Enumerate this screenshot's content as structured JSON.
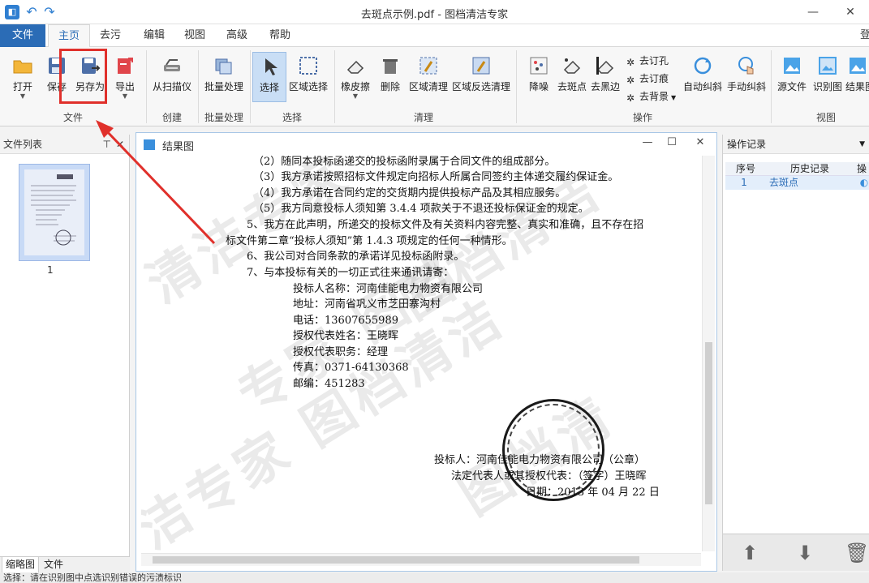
{
  "window": {
    "title": "去斑点示例.pdf - 图档清洁专家",
    "min_glyph": "—",
    "max_glyph": "☐",
    "close_glyph": "✕"
  },
  "menu_tabs": {
    "file": "文件",
    "home": "主页",
    "denoise": "去污",
    "edit": "编辑",
    "view": "视图",
    "advanced": "高级",
    "help": "帮助",
    "login": "登"
  },
  "ribbon": {
    "file_group": {
      "label": "文件",
      "open": "打开",
      "save": "保存",
      "save_as": "另存为",
      "export": "导出"
    },
    "create_group": {
      "label": "创建",
      "scanner": "从扫描仪"
    },
    "batch_group": {
      "label": "批量处理",
      "batch": "批量处理"
    },
    "select_group": {
      "label": "选择",
      "select": "选择",
      "region_select": "区域选择"
    },
    "clean_group": {
      "label": "清理",
      "eraser": "橡皮擦",
      "delete": "删除",
      "region_clean": "区域清理",
      "region_inverse_clean": "区域反选清理"
    },
    "ops_group": {
      "label": "操作",
      "denoise": "降噪",
      "remove_spots": "去斑点",
      "remove_black_edges": "去黑边",
      "remove_holes": "去订孔",
      "remove_staple_marks": "去订痕",
      "remove_background": "去背景",
      "auto_deskew": "自动纠斜",
      "manual_deskew": "手动纠斜"
    },
    "view_group": {
      "label": "视图",
      "source": "源文件",
      "recognize": "识别图",
      "result": "结果图"
    }
  },
  "left_panel": {
    "title": "文件列表",
    "page_number": "1",
    "tabs": [
      "缩略图",
      "文件"
    ]
  },
  "doc_window": {
    "title": "结果图",
    "lines": [
      "（2）随同本投标函递交的投标函附录属于合同文件的组成部分。",
      "（3）我方承诺按照招标文件规定向招标人所属合同签约主体递交履约保证金。",
      "（4）我方承诺在合同约定的交货期内提供投标产品及其相应服务。",
      "（5）我方同意投标人须知第 3.4.4 项款关于不退还投标保证金的规定。",
      "5、我方在此声明，所递交的投标文件及有关资料内容完整、真实和准确，且不存在招",
      "标文件第二章“投标人须知”第 1.4.3 项规定的任何一种情形。",
      "6、我公司对合同条款的承诺详见投标函附录。",
      "7、与本投标有关的一切正式往来通讯请寄：",
      "投标人名称：河南佳能电力物资有限公司",
      "地址：河南省巩义市芝田寨沟村",
      "电话：13607655989",
      "授权代表姓名：王晓晖",
      "授权代表职务：经理",
      "传真：0371-64130368",
      "邮编：451283",
      "投标人：河南佳能电力物资有限公司（公章）",
      "法定代表人或其授权代表：（签字）王晓晖",
      "日期：2013 年 04 月 22 日"
    ],
    "watermark": [
      "清洁专家",
      "图档清洁",
      "图档清",
      "专家 图档",
      "洁专家 图档清洁"
    ]
  },
  "right_panel": {
    "title": "操作记录",
    "columns": [
      "序号",
      "历史记录",
      "操"
    ],
    "rows": [
      {
        "index": "1",
        "action": "去斑点"
      }
    ]
  },
  "status": {
    "text": "选择：请在识别图中点选识别错误的污渍标识"
  },
  "colors": {
    "accent": "#2b6cb6",
    "highlight": "#e0302b"
  }
}
